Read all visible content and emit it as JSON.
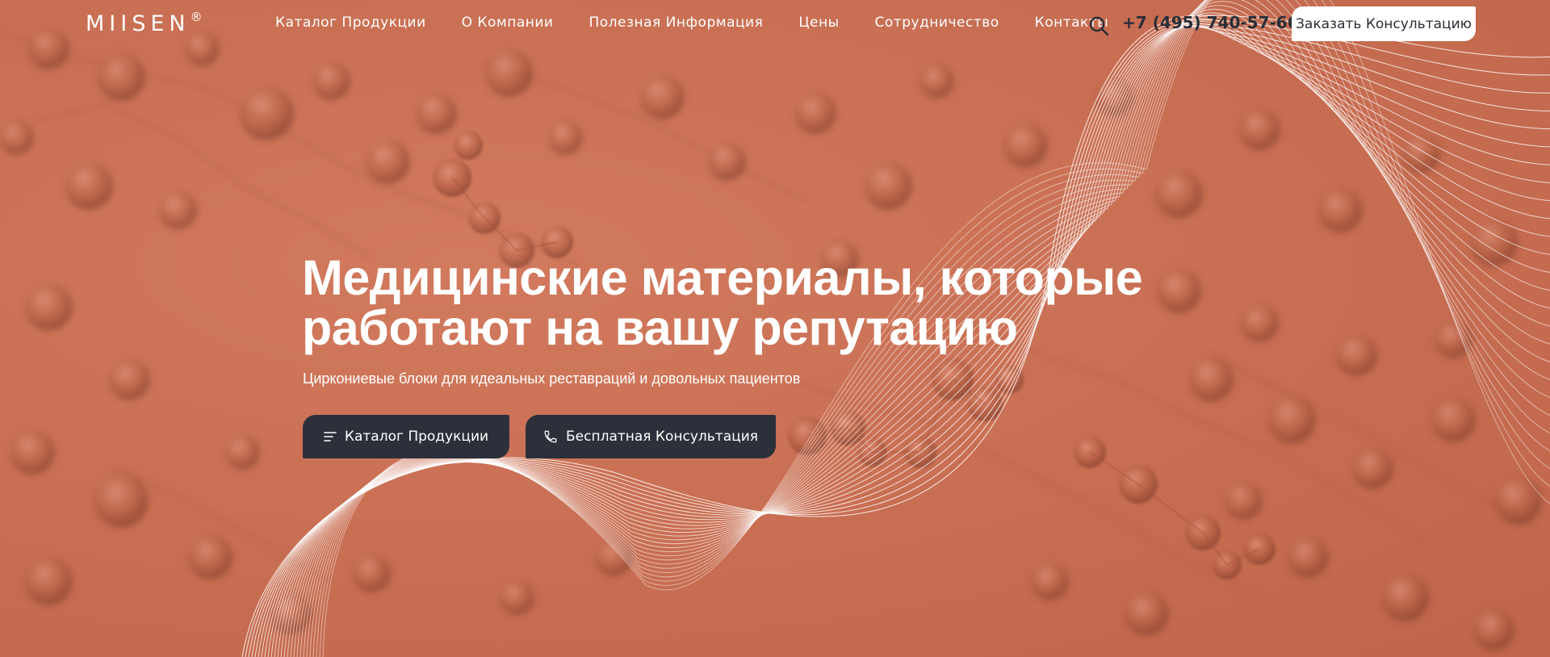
{
  "brand": {
    "logo_text": "MIISEN",
    "logo_mark": "®"
  },
  "nav": {
    "items": [
      {
        "label": "Каталог Продукции"
      },
      {
        "label": "О Компании"
      },
      {
        "label": "Полезная Информация"
      },
      {
        "label": "Цены"
      },
      {
        "label": "Сотрудничество"
      },
      {
        "label": "Контакты"
      }
    ]
  },
  "header": {
    "search_icon": "search-icon",
    "phone": "+7 (495) 740-57-66",
    "cta_label": "Заказать Консультацию"
  },
  "hero": {
    "title_line1": "Медицинские материалы, которые",
    "title_line2": "работают на вашу репутацию",
    "subtitle": "Циркониевые блоки для идеальных реставраций и довольных пациентов",
    "buttons": [
      {
        "label": "Каталог Продукции",
        "icon": "menu-lines-icon"
      },
      {
        "label": "Бесплатная Консультация",
        "icon": "phone-icon"
      }
    ]
  },
  "colors": {
    "background": "#c86e52",
    "dark_button": "#2c303a",
    "text_light": "#ffffff",
    "text_dark": "#2a2e37"
  }
}
